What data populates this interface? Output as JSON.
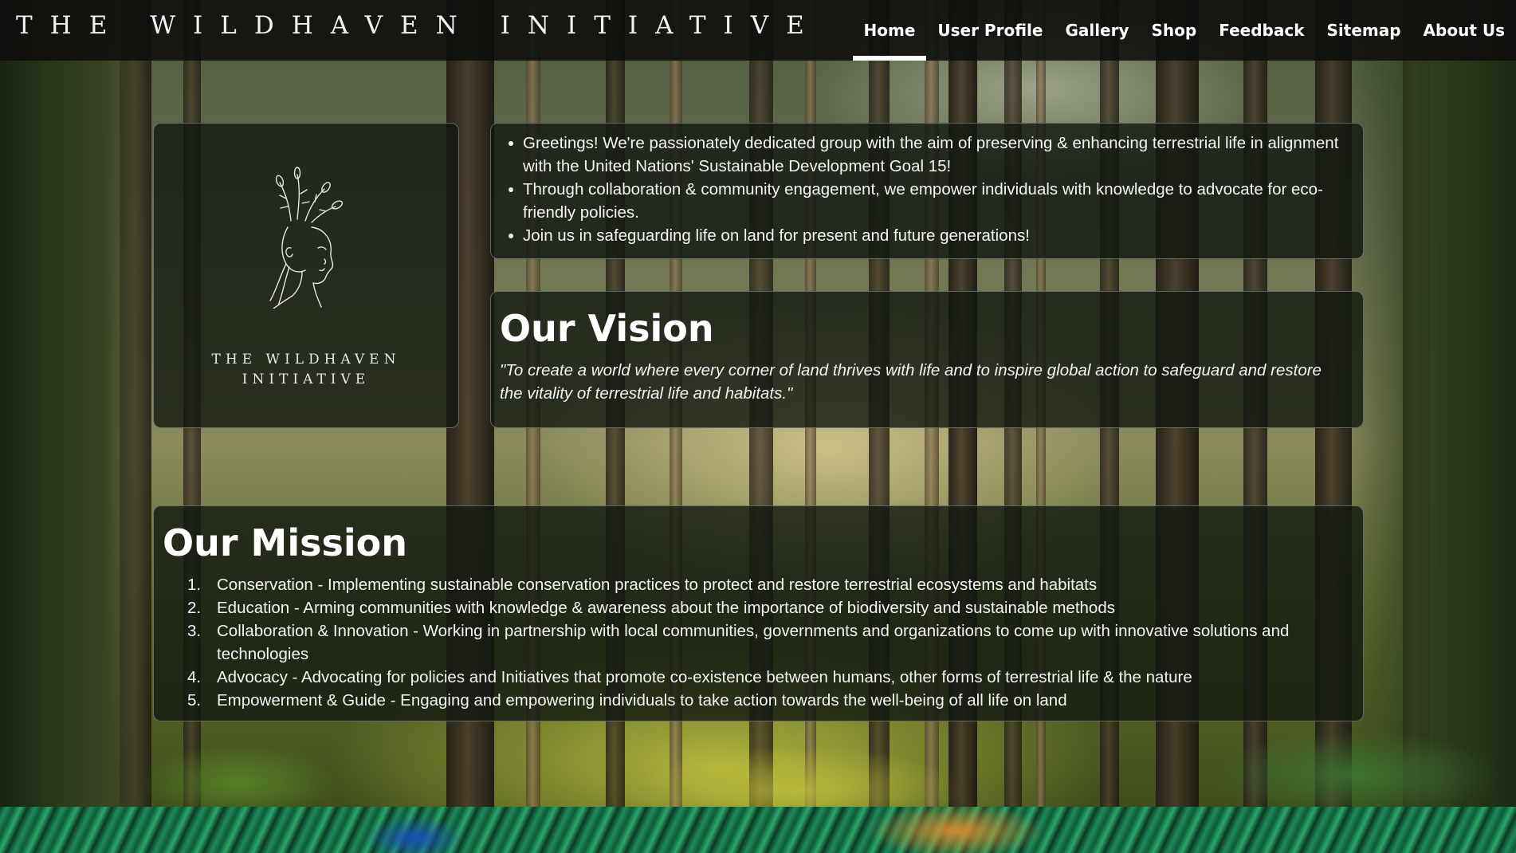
{
  "header": {
    "brand": "THE WILDHAVEN INITIATIVE",
    "nav": [
      {
        "label": "Home",
        "active": true
      },
      {
        "label": "User Profile",
        "active": false
      },
      {
        "label": "Gallery",
        "active": false
      },
      {
        "label": "Shop",
        "active": false
      },
      {
        "label": "Feedback",
        "active": false
      },
      {
        "label": "Sitemap",
        "active": false
      },
      {
        "label": "About Us",
        "active": false
      }
    ]
  },
  "logo": {
    "line1": "THE WILDHAVEN",
    "line2": "INITIATIVE",
    "icon": "woman-with-flowers-line-art"
  },
  "intro": {
    "bullets": [
      "Greetings! We're passionately dedicated group with the aim of preserving & enhancing terrestrial life in alignment with the United Nations' Sustainable Development Goal 15!",
      "Through collaboration & community engagement, we empower individuals with knowledge to advocate for eco-friendly policies.",
      "Join us in safeguarding life on land for present and future generations!"
    ]
  },
  "vision": {
    "title": "Our Vision",
    "text": "\"To create a world where every corner of land thrives with life and to inspire global action to safeguard and restore the vitality of terrestrial life and habitats.\""
  },
  "mission": {
    "title": "Our Mission",
    "items": [
      {
        "num": "1.",
        "text": "Conservation - Implementing sustainable conservation practices to protect and restore terrestrial ecosystems and habitats"
      },
      {
        "num": "2.",
        "text": "Education - Arming communities with knowledge & awareness about the importance of biodiversity and sustainable methods"
      },
      {
        "num": "3.",
        "text": "Collaboration & Innovation - Working in partnership with local communities, governments and organizations to come up with innovative solutions and technologies"
      },
      {
        "num": "4.",
        "text": "Advocacy - Advocating for policies and Initiatives that promote co-existence between humans, other forms of terrestrial life & the nature"
      },
      {
        "num": "5.",
        "text": "Empowerment & Guide - Engaging and empowering individuals to take action towards the well-being of all life on land"
      }
    ]
  },
  "colors": {
    "header_bg": "#0c0e0c",
    "panel_bg": "#121810",
    "text": "#ffffff",
    "active_underline": "#ffffff"
  }
}
